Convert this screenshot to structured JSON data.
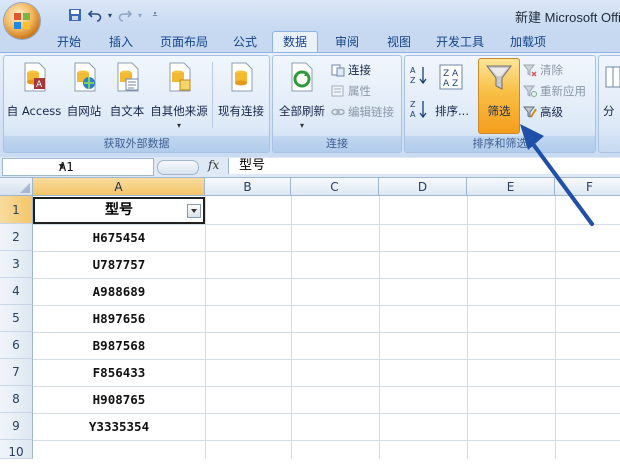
{
  "window": {
    "title": "新建 Microsoft Offi"
  },
  "tabs": [
    "开始",
    "插入",
    "页面布局",
    "公式",
    "数据",
    "审阅",
    "视图",
    "开发工具",
    "加载项"
  ],
  "active_tab": "数据",
  "ribbon": {
    "get_external": {
      "label": "获取外部数据",
      "buttons": [
        "自 Access",
        "自网站",
        "自文本",
        "自其他来源",
        "现有连接"
      ]
    },
    "connections": {
      "label": "连接",
      "refresh_all": "全部刷新",
      "items": [
        "连接",
        "属性",
        "编辑链接"
      ]
    },
    "sort_filter": {
      "label": "排序和筛选",
      "sort": "排序...",
      "filter": "筛选",
      "clear": "清除",
      "reapply": "重新应用",
      "advanced": "高级"
    },
    "partial_next": "分"
  },
  "formula_bar": {
    "name_box": "A1",
    "fx": "fx",
    "value": "型号"
  },
  "columns": [
    "A",
    "B",
    "C",
    "D",
    "E",
    "F"
  ],
  "rows": [
    "1",
    "2",
    "3",
    "4",
    "5",
    "6",
    "7",
    "8",
    "9",
    "10"
  ],
  "cells": {
    "A1": "型号",
    "A_values": [
      "H675454",
      "U787757",
      "A988689",
      "H897656",
      "B987568",
      "F856433",
      "H908765",
      "Y3335354"
    ]
  },
  "colors": {
    "accent_arrow": "#1f4fa8",
    "active_filter": "#f5a623"
  }
}
